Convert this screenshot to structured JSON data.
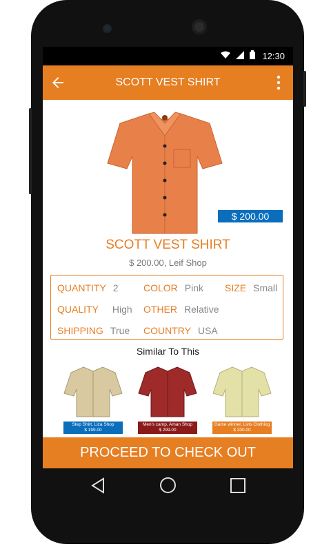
{
  "status": {
    "time": "12:30"
  },
  "appbar": {
    "title": "SCOTT VEST SHIRT"
  },
  "product": {
    "name": "SCOTT VEST SHIRT",
    "price_badge": "$ 200.00",
    "subtitle": "$ 200.00, Leif Shop",
    "image_color": "#e8804a"
  },
  "attributes": {
    "quantity": {
      "label": "QUANTITY",
      "value": "2"
    },
    "color": {
      "label": "COLOR",
      "value": "Pink"
    },
    "size": {
      "label": "SIZE",
      "value": "Small"
    },
    "quality": {
      "label": "QUALITY",
      "value": "High"
    },
    "other": {
      "label": "OTHER",
      "value": "Relative"
    },
    "shipping": {
      "label": "SHIPPING",
      "value": "True"
    },
    "country": {
      "label": "COUNTRY",
      "value": "USA"
    }
  },
  "similar": {
    "title": "Similar To This",
    "items": [
      {
        "caption_line1": "Step Shirt, Liza Shop",
        "caption_line2": "$ 199.00",
        "caption_color": "#0a6ebd",
        "shirt_color": "#d8c9a0"
      },
      {
        "caption_line1": "Men's camp, Aman Shop",
        "caption_line2": "$ 299.00",
        "caption_color": "#8b1a1a",
        "shirt_color": "#9e2a2a"
      },
      {
        "caption_line1": "Game winner, Livis Clothing",
        "caption_line2": "$ 200.00",
        "caption_color": "#e67e22",
        "shirt_color": "#e3e0a8"
      }
    ]
  },
  "checkout": {
    "label": "PROCEED TO CHECK OUT"
  },
  "colors": {
    "accent": "#e67e22",
    "badge_blue": "#0a6ebd"
  },
  "icons": [
    "back-arrow-icon",
    "overflow-menu-icon",
    "wifi-icon",
    "signal-icon",
    "battery-icon",
    "nav-back-icon",
    "nav-home-icon",
    "nav-recents-icon"
  ]
}
